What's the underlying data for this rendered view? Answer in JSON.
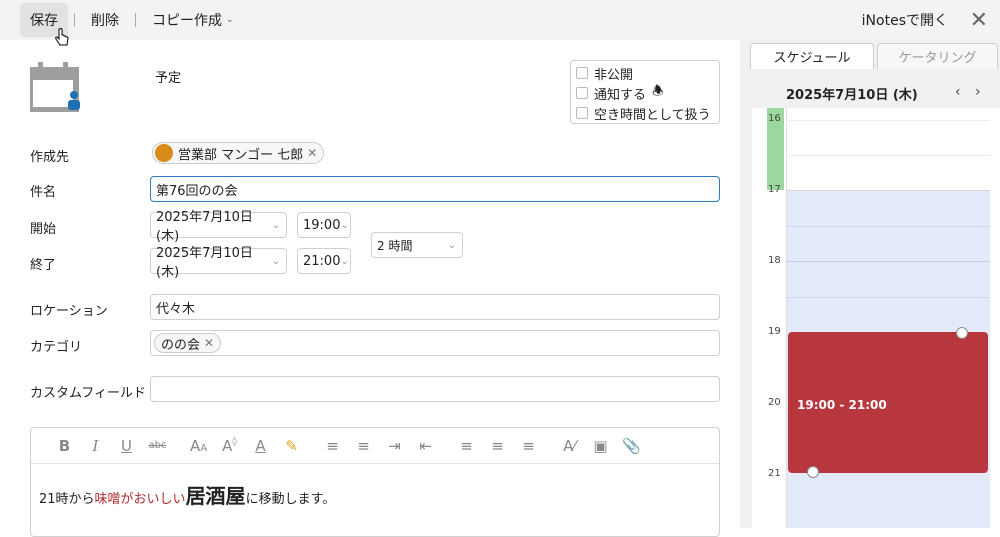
{
  "toolbar": {
    "save": "保存",
    "delete": "削除",
    "copy": "コピー作成",
    "open_inotes": "iNotesで開く"
  },
  "type_label": "予定",
  "options": {
    "private": "非公開",
    "notify": "通知する",
    "free_time": "空き時間として扱う"
  },
  "form": {
    "send_to_label": "作成先",
    "send_to_value": "営業部 マンゴー 七郎",
    "subject_label": "件名",
    "subject_value": "第76回のの会",
    "start_label": "開始",
    "start_date": "2025年7月10日 (木)",
    "start_time": "19:00",
    "end_label": "終了",
    "end_date": "2025年7月10日 (木)",
    "end_time": "21:00",
    "duration": "2 時間",
    "location_label": "ロケーション",
    "location_value": "代々木",
    "category_label": "カテゴリ",
    "category_value": "のの会",
    "custom_label": "カスタムフィールド",
    "custom_value": ""
  },
  "editor": {
    "text1": "21時から",
    "text2": "味噌がおいしい",
    "text3": "居酒屋",
    "text4": "に移動します。"
  },
  "side": {
    "tab_schedule": "スケジュール",
    "tab_catering": "ケータリング",
    "date": "2025年7月10日 (木)",
    "hours": [
      "16",
      "17",
      "18",
      "19",
      "20",
      "21"
    ],
    "event_time": "19:00 - 21:00",
    "event_color": "#b8373e"
  }
}
